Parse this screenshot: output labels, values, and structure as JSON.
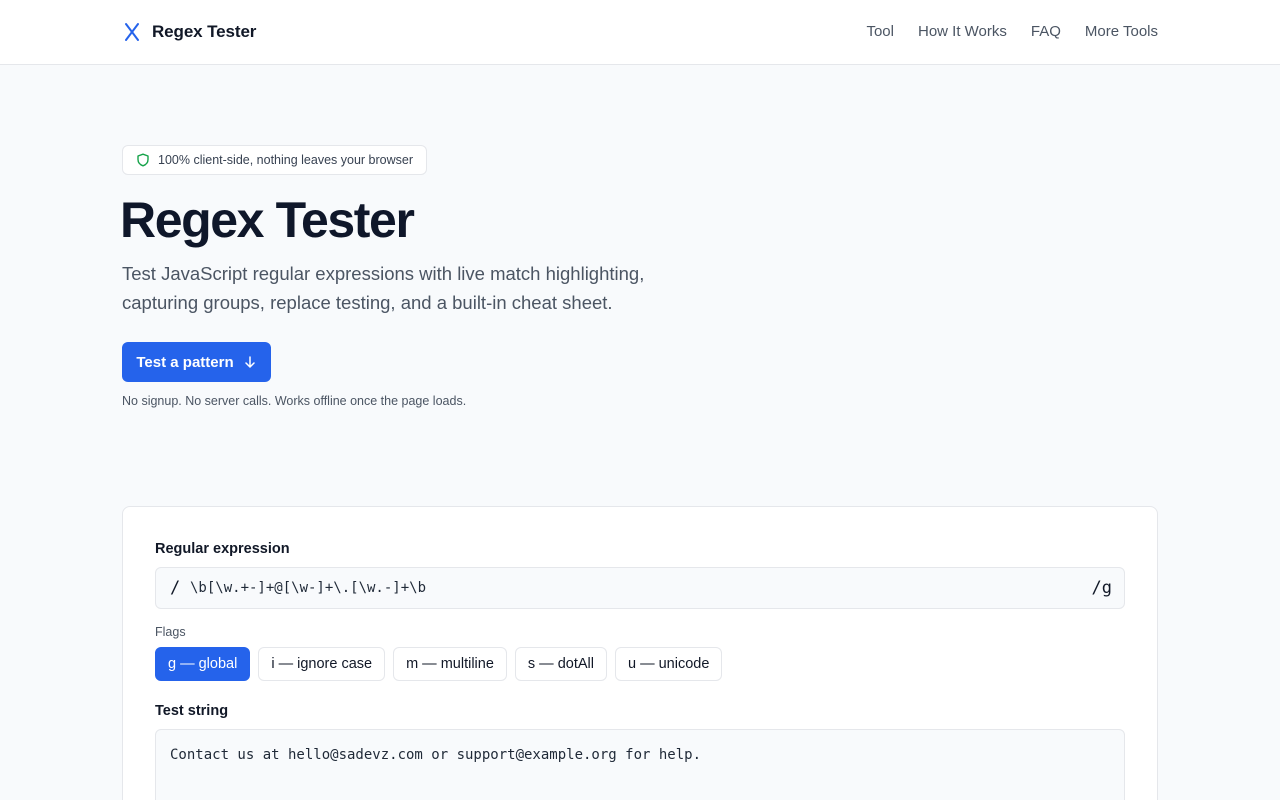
{
  "header": {
    "brand": "Regex Tester",
    "brand_icon": "x-mark-icon",
    "nav": [
      "Tool",
      "How It Works",
      "FAQ",
      "More Tools"
    ]
  },
  "hero": {
    "badge": "100% client-side, nothing leaves your browser",
    "badge_icon": "shield-icon",
    "title": "Regex Tester",
    "subtitle_line1": "Test JavaScript regular expressions with live match highlighting,",
    "subtitle_line2": "capturing groups, replace testing, and a built-in cheat sheet.",
    "cta_label": "Test a pattern",
    "cta_icon": "arrow-down-icon",
    "note": "No signup. No server calls. Works offline once the page loads."
  },
  "tool": {
    "regex_label": "Regular expression",
    "delim_open": "/",
    "pattern": "\\b[\\w.+-]+@[\\w-]+\\.[\\w.-]+\\b",
    "delim_close": "/g",
    "flags_label": "Flags",
    "flags": [
      {
        "label": "g — global",
        "active": true
      },
      {
        "label": "i — ignore case",
        "active": false
      },
      {
        "label": "m — multiline",
        "active": false
      },
      {
        "label": "s — dotAll",
        "active": false
      },
      {
        "label": "u — unicode",
        "active": false
      }
    ],
    "test_label": "Test string",
    "test_string": "Contact us at hello@sadevz.com or support@example.org for help."
  },
  "colors": {
    "accent": "#2563eb",
    "badge_icon": "#16a34a",
    "background": "#f8fafc"
  }
}
